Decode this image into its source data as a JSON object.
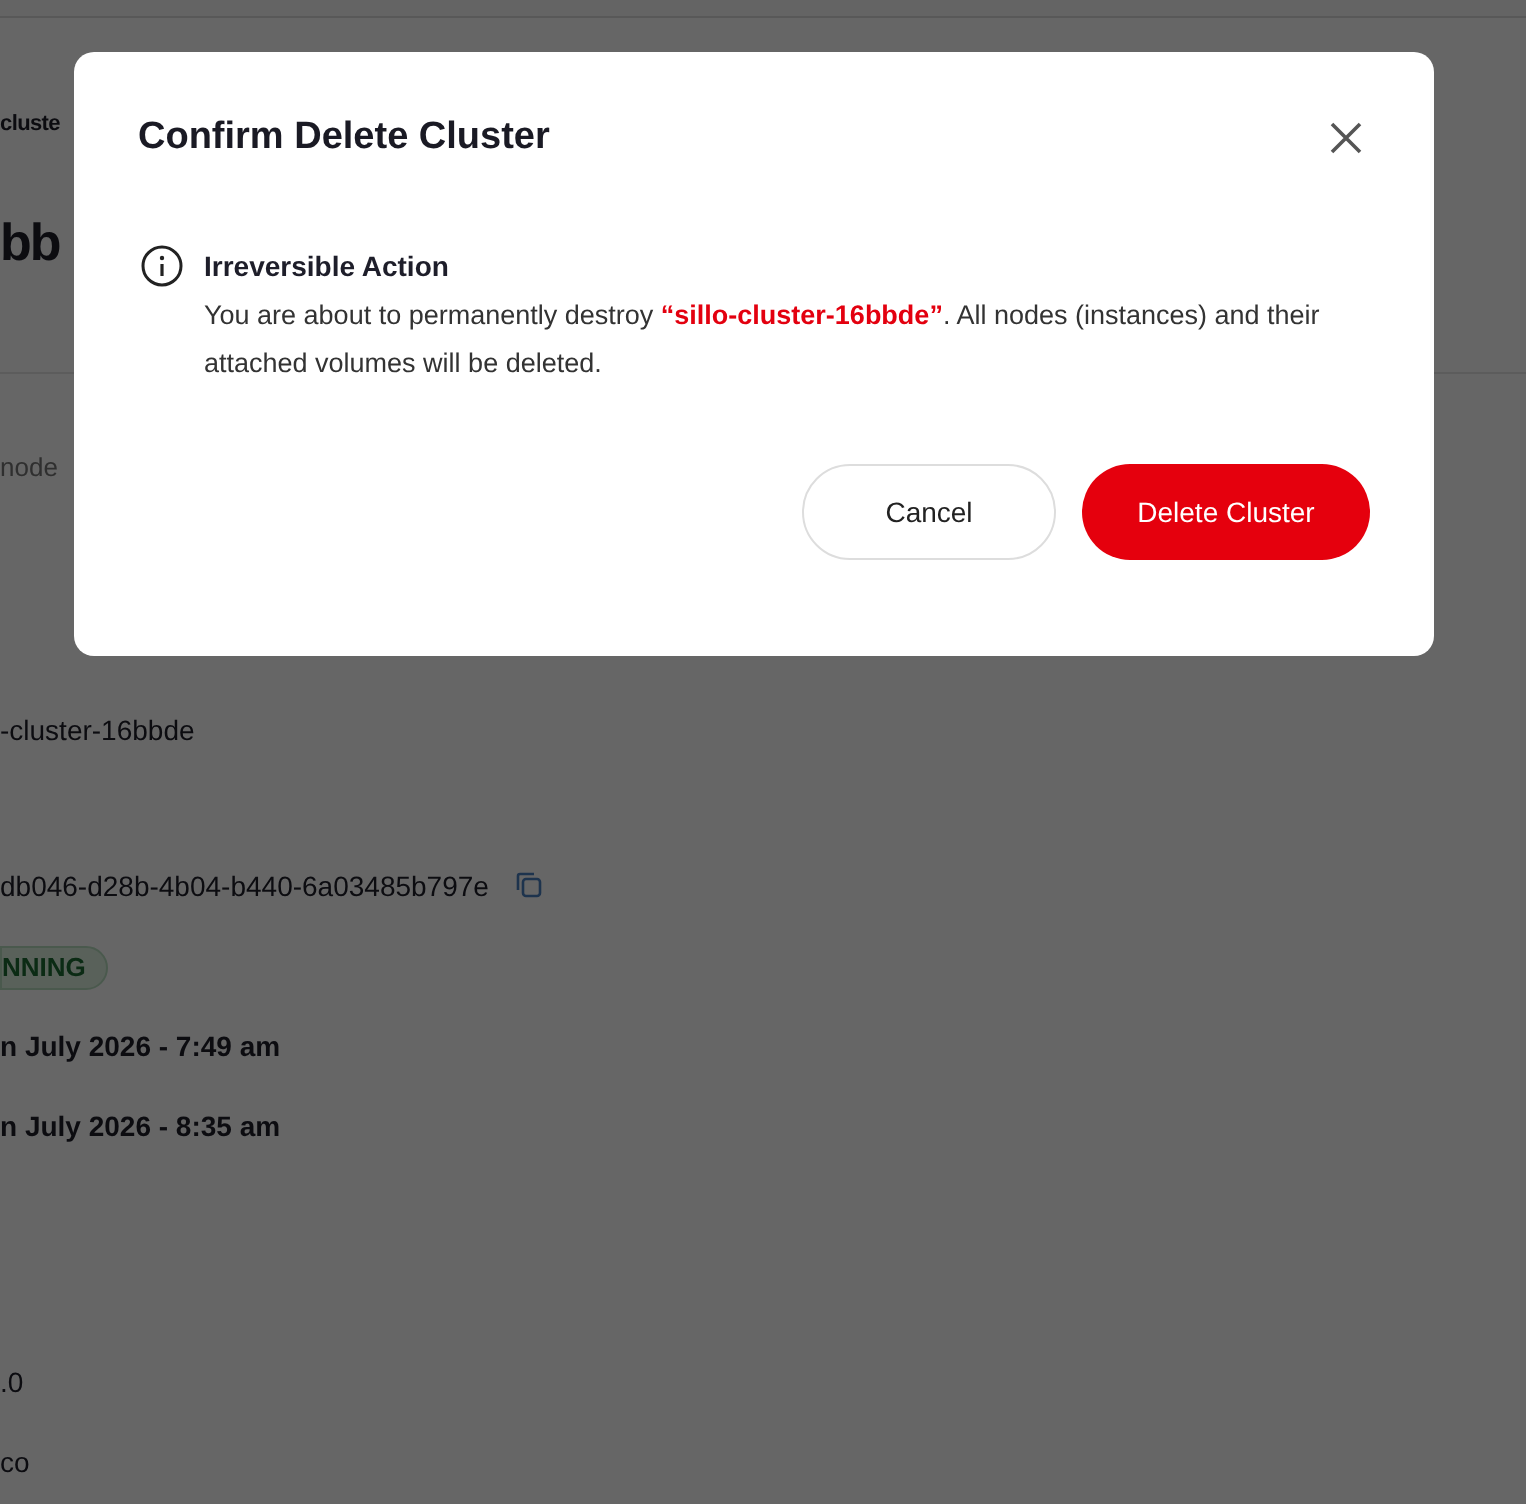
{
  "page": {
    "breadcrumb": "cluste",
    "heading": "bb",
    "tab": "node",
    "fields": [
      {
        "kind": "text",
        "value": "-cluster-16bbde"
      },
      {
        "kind": "copy",
        "value": "db046-d28b-4b04-b440-6a03485b797e"
      },
      {
        "kind": "badge",
        "value": "NNING"
      },
      {
        "kind": "bold",
        "value": "n July 2026 - 7:49 am"
      },
      {
        "kind": "bold",
        "value": "n July 2026 - 8:35 am"
      },
      {
        "kind": "text",
        "value": ".0"
      },
      {
        "kind": "text",
        "value": "co"
      }
    ]
  },
  "dialog": {
    "title": "Confirm Delete Cluster",
    "alert_title": "Irreversible Action",
    "message": "You are about to permanently destroy **“sillo-cluster-16bbde”**. All nodes (instances) and their attached volumes will be deleted.",
    "buttons": [
      {
        "kind": "secondary",
        "label": "Cancel"
      },
      {
        "kind": "danger",
        "label": "Delete Cluster"
      }
    ]
  }
}
